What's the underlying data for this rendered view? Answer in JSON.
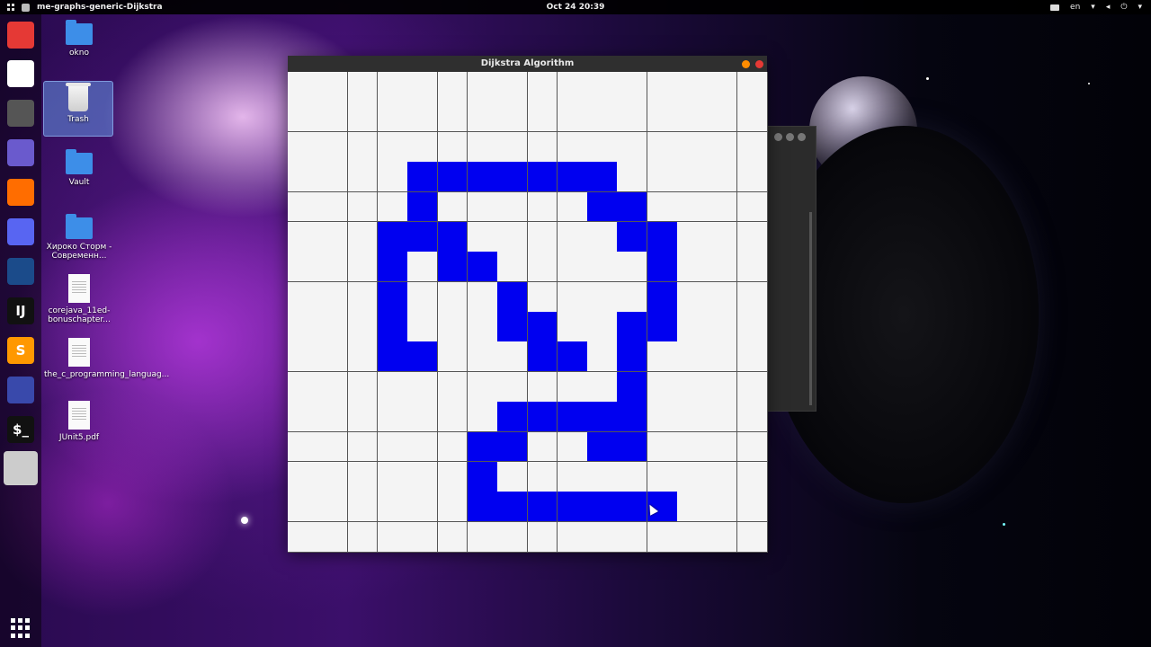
{
  "topbar": {
    "app_title": "me-graphs-generic-Dijkstra",
    "datetime": "Oct 24  20:39",
    "language": "en"
  },
  "dock": {
    "items": [
      {
        "name": "text-editor",
        "glyph": "",
        "color": "#e53935"
      },
      {
        "name": "files",
        "glyph": "",
        "color": "#ffffff"
      },
      {
        "name": "settings",
        "glyph": "",
        "color": "#555555"
      },
      {
        "name": "screenshot",
        "glyph": "",
        "color": "#6a5acd"
      },
      {
        "name": "firefox",
        "glyph": "",
        "color": "#ff6d00"
      },
      {
        "name": "discord",
        "glyph": "",
        "color": "#5865f2"
      },
      {
        "name": "steam",
        "glyph": "",
        "color": "#1b4b8a"
      },
      {
        "name": "intellij",
        "glyph": "IJ",
        "color": "#111111"
      },
      {
        "name": "sublime",
        "glyph": "S",
        "color": "#ff9800"
      },
      {
        "name": "recorder",
        "glyph": "",
        "color": "#3949ab"
      },
      {
        "name": "terminal",
        "glyph": "$_",
        "color": "#111111"
      },
      {
        "name": "java-app",
        "glyph": "",
        "color": "#cccccc"
      }
    ]
  },
  "desktop": {
    "icons": [
      {
        "label": "okno",
        "kind": "home-folder"
      },
      {
        "label": "Trash",
        "kind": "trash"
      },
      {
        "label": "Vault",
        "kind": "folder"
      },
      {
        "label": "Хироко Сторм - Современн...",
        "kind": "folder"
      },
      {
        "label": "corejava_11ed-bonuschapter...",
        "kind": "pdf"
      },
      {
        "label": "the_c_programming_languag...",
        "kind": "pdf"
      },
      {
        "label": "JUnit5.pdf",
        "kind": "pdf"
      }
    ]
  },
  "window": {
    "title": "Dijkstra Algorithm",
    "grid": {
      "cols": 16,
      "rows": 16,
      "path_cells": [
        [
          3,
          4
        ],
        [
          3,
          5
        ],
        [
          3,
          6
        ],
        [
          3,
          7
        ],
        [
          3,
          8
        ],
        [
          3,
          9
        ],
        [
          3,
          10
        ],
        [
          4,
          4
        ],
        [
          4,
          10
        ],
        [
          4,
          11
        ],
        [
          5,
          3
        ],
        [
          5,
          4
        ],
        [
          5,
          5
        ],
        [
          5,
          11
        ],
        [
          5,
          12
        ],
        [
          6,
          3
        ],
        [
          6,
          5
        ],
        [
          6,
          6
        ],
        [
          6,
          12
        ],
        [
          7,
          3
        ],
        [
          7,
          7
        ],
        [
          7,
          12
        ],
        [
          8,
          3
        ],
        [
          8,
          7
        ],
        [
          8,
          8
        ],
        [
          8,
          11
        ],
        [
          8,
          12
        ],
        [
          9,
          3
        ],
        [
          9,
          4
        ],
        [
          9,
          8
        ],
        [
          9,
          9
        ],
        [
          9,
          11
        ],
        [
          10,
          11
        ],
        [
          11,
          7
        ],
        [
          11,
          8
        ],
        [
          11,
          9
        ],
        [
          11,
          10
        ],
        [
          11,
          11
        ],
        [
          12,
          6
        ],
        [
          12,
          7
        ],
        [
          12,
          10
        ],
        [
          12,
          11
        ],
        [
          13,
          6
        ],
        [
          14,
          6
        ],
        [
          14,
          7
        ],
        [
          14,
          8
        ],
        [
          14,
          9
        ],
        [
          14,
          10
        ],
        [
          14,
          11
        ],
        [
          14,
          12
        ]
      ]
    },
    "colors": {
      "path": "#0000f0",
      "empty": "#f4f4f4",
      "close_button": "#e53935",
      "minimize_button": "#ff8c00"
    }
  }
}
